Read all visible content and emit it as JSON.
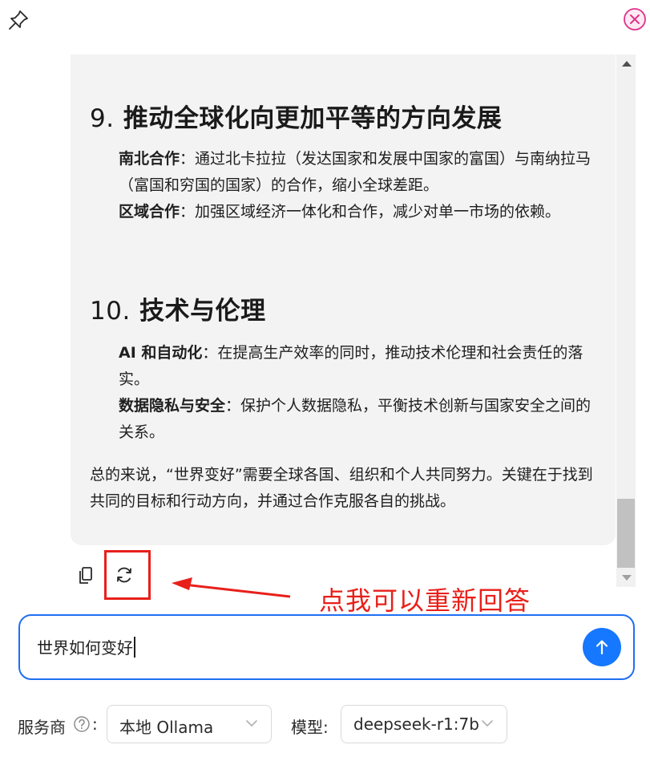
{
  "content": {
    "section9": {
      "number": "9.",
      "title": "推动全球化向更加平等的方向发展",
      "items": [
        {
          "label": "南北合作",
          "text": "：通过北卡拉拉（发达国家和发展中国家的富国）与南纳拉马（富国和穷国的国家）的合作，缩小全球差距。"
        },
        {
          "label": "区域合作",
          "text": "：加强区域经济一体化和合作，减少对单一市场的依赖。"
        }
      ]
    },
    "section10": {
      "number": "10.",
      "title": "技术与伦理",
      "items": [
        {
          "label": "AI 和自动化",
          "text": "：在提高生产效率的同时，推动技术伦理和社会责任的落实。"
        },
        {
          "label": "数据隐私与安全",
          "text": "：保护个人数据隐私，平衡技术创新与国家安全之间的关系。"
        }
      ]
    },
    "summary": "总的来说，“世界变好”需要全球各国、组织和个人共同努力。关键在于找到共同的目标和行动方向，并通过合作克服各自的挑战。"
  },
  "annotation": {
    "text": "点我可以重新回答",
    "color": "#e8201a"
  },
  "input": {
    "value": "世界如何变好"
  },
  "footer": {
    "provider_label": "服务商",
    "colon": ":",
    "provider_value": "本地 Ollama",
    "model_label": "模型:",
    "model_value": "deepseek-r1:7b"
  },
  "icons": {
    "pin": "pin-icon",
    "close": "close-icon",
    "copy": "copy-icon",
    "refresh": "refresh-icon",
    "send": "arrow-up-icon",
    "help": "question-circle-icon",
    "chevron": "chevron-down-icon"
  },
  "colors": {
    "accent": "#1677ff",
    "close": "#e0338a",
    "panel_bg": "#f3f3f3"
  }
}
